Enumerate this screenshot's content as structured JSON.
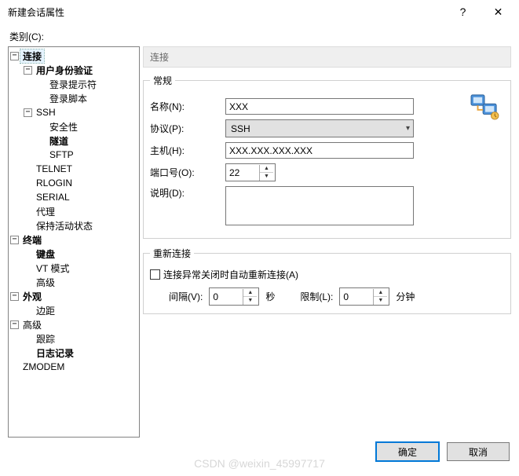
{
  "window": {
    "title": "新建会话属性",
    "help": "?",
    "close": "✕"
  },
  "category_label": "类别(C):",
  "tree": {
    "connection": "连接",
    "user_auth": "用户身份验证",
    "login_prompt": "登录提示符",
    "login_script": "登录脚本",
    "ssh": "SSH",
    "security": "安全性",
    "tunnel": "隧道",
    "sftp": "SFTP",
    "telnet": "TELNET",
    "rlogin": "RLOGIN",
    "serial": "SERIAL",
    "proxy": "代理",
    "keepalive": "保持活动状态",
    "terminal": "终端",
    "keyboard": "键盘",
    "vt": "VT 模式",
    "advanced_term": "高级",
    "appearance": "外观",
    "margin": "边距",
    "advanced": "高级",
    "trace": "跟踪",
    "logging": "日志记录",
    "zmodem": "ZMODEM"
  },
  "panel": {
    "heading": "连接",
    "general_legend": "常规",
    "name_label": "名称(N):",
    "name_value": "XXX",
    "protocol_label": "协议(P):",
    "protocol_value": "SSH",
    "host_label": "主机(H):",
    "host_value": "XXX.XXX.XXX.XXX",
    "port_label": "端口号(O):",
    "port_value": "22",
    "desc_label": "说明(D):",
    "desc_value": ""
  },
  "reconnect": {
    "legend": "重新连接",
    "checkbox_label": "连接异常关闭时自动重新连接(A)",
    "interval_label": "间隔(V):",
    "interval_value": "0",
    "interval_unit": "秒",
    "limit_label": "限制(L):",
    "limit_value": "0",
    "limit_unit": "分钟"
  },
  "buttons": {
    "ok": "确定",
    "cancel": "取消"
  },
  "watermark": "CSDN @weixin_45997717"
}
